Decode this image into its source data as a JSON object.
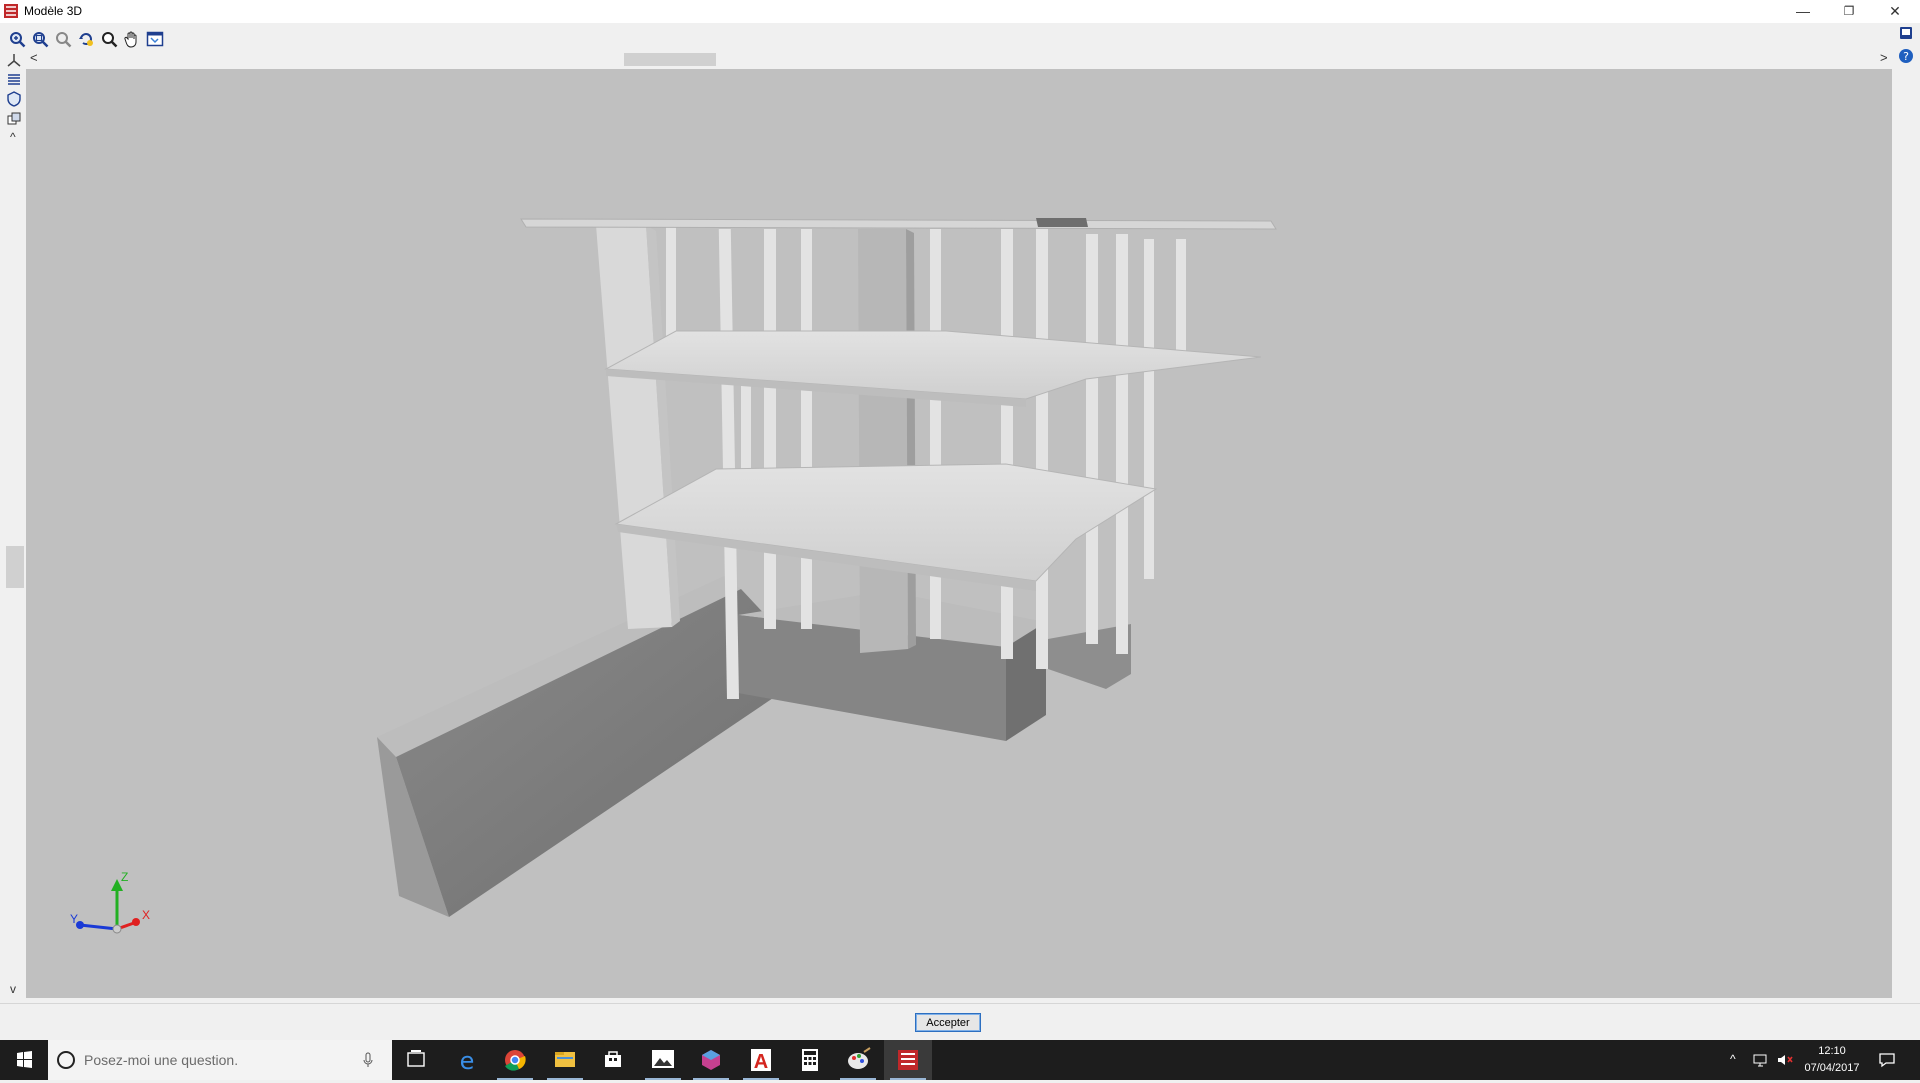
{
  "window": {
    "title": "Modèle 3D",
    "minimize_glyph": "—",
    "restore_glyph": "❐",
    "close_glyph": "✕"
  },
  "toolbar": {
    "icons": [
      "zoom-all-icon",
      "zoom-window-icon",
      "zoom-previous-icon",
      "rotate-view-icon",
      "zoom-icon",
      "pan-hand-icon",
      "view-select-icon"
    ]
  },
  "right_toolbar": {
    "icons": [
      "book-icon",
      "help-icon"
    ]
  },
  "left_toolbar": {
    "icons": [
      "axes-icon",
      "layers-icon",
      "shield-icon",
      "views-icon"
    ],
    "collapse_glyph": "^"
  },
  "hscroll": {
    "left_glyph": "<",
    "right_glyph": ">"
  },
  "vscroll": {
    "down_glyph": "v"
  },
  "axis_labels": {
    "z": "Z",
    "y": "Y",
    "x": "X"
  },
  "dialog": {
    "accept_label": "Accepter"
  },
  "taskbar": {
    "search_placeholder": "Posez-moi une question.",
    "apps": [
      "task-view-icon",
      "edge-icon",
      "chrome-icon",
      "file-explorer-icon",
      "store-icon",
      "photos-icon",
      "cube-app-icon",
      "acrobat-icon",
      "calculator-icon",
      "paint-icon",
      "cype-app-icon"
    ],
    "time": "12:10",
    "date": "07/04/2017"
  },
  "colors": {
    "viewport_bg": "#c0c0c0",
    "taskbar_bg": "#1d1d1d",
    "accent": "#2d6fc0",
    "axis_x": "#e02020",
    "axis_y": "#1a3ad6",
    "axis_z": "#22b022"
  }
}
